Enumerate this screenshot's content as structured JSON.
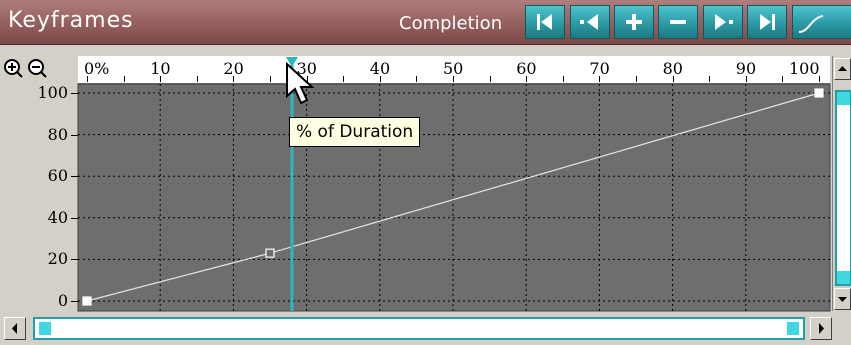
{
  "panel": {
    "title": "Keyframes",
    "mode_label": "Completion"
  },
  "toolbar": [
    {
      "name": "first-keyframe-button",
      "icon": "jump-to-first-icon"
    },
    {
      "name": "previous-keyframe-button",
      "icon": "previous-keyframe-icon"
    },
    {
      "name": "add-keyframe-button",
      "icon": "plus-icon"
    },
    {
      "name": "remove-keyframe-button",
      "icon": "minus-icon"
    },
    {
      "name": "next-keyframe-button",
      "icon": "next-keyframe-icon"
    },
    {
      "name": "last-keyframe-button",
      "icon": "jump-to-last-icon"
    },
    {
      "name": "curve-mode-button",
      "icon": "curve-icon"
    }
  ],
  "ruler": {
    "ticks": [
      "0%",
      "10",
      "20",
      "30",
      "40",
      "50",
      "60",
      "70",
      "80",
      "90",
      "100"
    ]
  },
  "y_axis": {
    "ticks": [
      "0",
      "20",
      "40",
      "60",
      "80",
      "100"
    ]
  },
  "curve": {
    "x_range": [
      0,
      100
    ],
    "y_range": [
      0,
      100
    ],
    "keyframes": [
      {
        "x": 0,
        "y": 0
      },
      {
        "x": 25,
        "y": 23
      },
      {
        "x": 100,
        "y": 100
      }
    ]
  },
  "playhead": {
    "value": 28
  },
  "tooltip": {
    "text": "% of Duration"
  },
  "colors": {
    "accent": "#2cb8c0",
    "plot_bg": "#6e6e6e",
    "header": "#9a6464",
    "tooltip_bg": "#ffffe1"
  }
}
